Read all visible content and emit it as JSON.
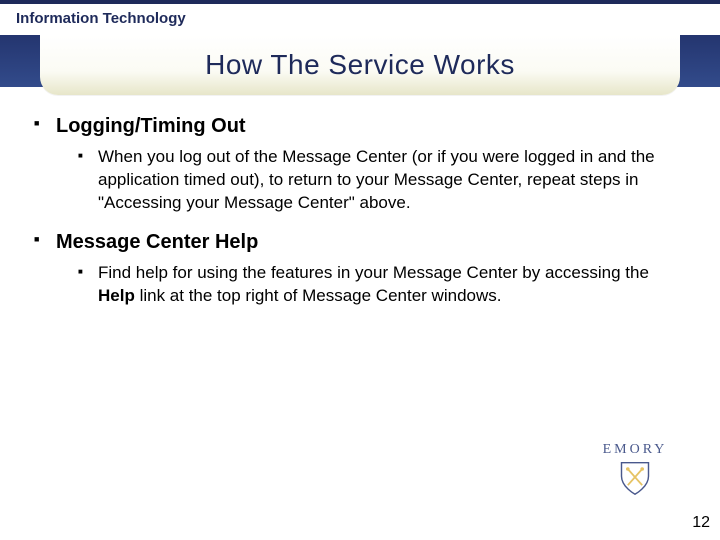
{
  "header": {
    "department": "Information Technology"
  },
  "title": "How The Service Works",
  "sections": [
    {
      "heading": "Logging/Timing Out",
      "items": [
        {
          "text": "When you log out of the Message Center (or if you were logged in and the application timed out), to return to your Message Center, repeat steps in \"Accessing your Message Center\" above."
        }
      ]
    },
    {
      "heading": "Message Center Help",
      "items": [
        {
          "prefix": "Find help for using the features in your Message Center by accessing the ",
          "bold": "Help",
          "suffix": " link at the top right of Message Center windows."
        }
      ]
    }
  ],
  "logo": {
    "text": "EMORY"
  },
  "page_number": "12"
}
